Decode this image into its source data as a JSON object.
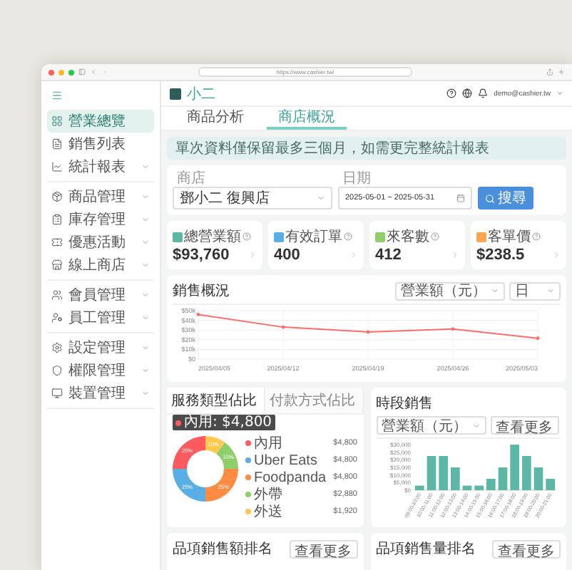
{
  "browser": {
    "url": "https://www.cashier.tw/"
  },
  "sidebar": {
    "groups": [
      {
        "items": [
          {
            "label": "營業總覽",
            "selected": true,
            "has_submenu": false
          },
          {
            "label": "銷售列表",
            "selected": false,
            "has_submenu": false
          },
          {
            "label": "統計報表",
            "selected": false,
            "has_submenu": true
          }
        ]
      },
      {
        "items": [
          {
            "label": "商品管理",
            "selected": false,
            "has_submenu": true
          },
          {
            "label": "庫存管理",
            "selected": false,
            "has_submenu": true
          },
          {
            "label": "優惠活動",
            "selected": false,
            "has_submenu": true
          },
          {
            "label": "線上商店",
            "selected": false,
            "has_submenu": true
          }
        ]
      },
      {
        "items": [
          {
            "label": "會員管理",
            "selected": false,
            "has_submenu": true
          },
          {
            "label": "員工管理",
            "selected": false,
            "has_submenu": true
          }
        ]
      },
      {
        "items": [
          {
            "label": "設定管理",
            "selected": false,
            "has_submenu": true
          },
          {
            "label": "權限管理",
            "selected": false,
            "has_submenu": true
          },
          {
            "label": "裝置管理",
            "selected": false,
            "has_submenu": true
          }
        ]
      }
    ]
  },
  "header": {
    "logo_text": "小二",
    "account": "demo@cashier.tw"
  },
  "tabs": [
    {
      "label": "商品分析",
      "selected": false
    },
    {
      "label": "商店概況",
      "selected": true
    }
  ],
  "notice": "單次資料僅保留最多三個月，如需更完整統計報表",
  "filter": {
    "store": {
      "label": "商店",
      "value": "鄧小二 復興店"
    },
    "date": {
      "label": "日期",
      "value": "2025-05-01 ~ 2025-05-31"
    },
    "search_button": "搜尋"
  },
  "stats": [
    {
      "label": "總營業額",
      "value": "$93,760",
      "color": "#5cb8a5"
    },
    {
      "label": "有效訂單",
      "value": "400",
      "color": "#5aaee6"
    },
    {
      "label": "來客數",
      "value": "412",
      "color": "#8fcf6a"
    },
    {
      "label": "客單價",
      "value": "$238.5",
      "color": "#ffa552"
    }
  ],
  "sales_overview": {
    "title": "銷售概況",
    "metric_select": "營業額（元）",
    "period_select": "日",
    "chart_data": {
      "type": "line",
      "grid": true,
      "x": [
        "2025/04/05",
        "2025/04/12",
        "2025/04/19",
        "2025/04/26",
        "2025/05/03"
      ],
      "series": [
        {
          "color": "#ff6b6b",
          "values": [
            46000,
            33000,
            28000,
            31000,
            21500
          ]
        }
      ],
      "ylim": [
        0,
        50000
      ],
      "yticks": [
        {
          "value": 0,
          "label": "$0"
        },
        {
          "value": 10000,
          "label": "$10k"
        },
        {
          "value": 20000,
          "label": "$20k"
        },
        {
          "value": 30000,
          "label": "$30k"
        },
        {
          "value": 40000,
          "label": "$40k"
        },
        {
          "value": 50000,
          "label": "$50k"
        }
      ]
    }
  },
  "share_card": {
    "tabs": [
      {
        "label": "服務類型佔比",
        "selected": true
      },
      {
        "label": "付款方式佔比",
        "selected": false
      }
    ],
    "chart_data": {
      "type": "donut",
      "categories": [
        "內用",
        "Uber Eats",
        "Foodpanda",
        "外帶",
        "外送"
      ],
      "values": [
        25,
        25,
        25,
        15,
        10
      ],
      "value_labels": [
        "25%",
        "25%",
        "25%",
        "15%",
        "10%"
      ],
      "colors": [
        "#ff5a5f",
        "#5aaee6",
        "#ff8c42",
        "#8fcf6a",
        "#ffc94d"
      ]
    },
    "legend_amounts": [
      "$4,800",
      "$4,800",
      "$4,800",
      "$2,880",
      "$1,920"
    ],
    "tooltip": {
      "text": "內用: $4,800",
      "color": "#ff5a5f"
    }
  },
  "hourly_card": {
    "title": "時段銷售",
    "metric_select": "營業額（元）",
    "more_button": "查看更多",
    "chart_data": {
      "type": "bar",
      "categories": [
        "09:00-10:00",
        "10:00-11:00",
        "11:00-12:00",
        "12:00-13:00",
        "13:00-14:00",
        "14:00-15:00",
        "15:00-16:00",
        "16:00-17:00",
        "17:00-18:00",
        "18:00-19:00",
        "19:00-20:00",
        "20:00-21:00"
      ],
      "series": [
        {
          "color": "#5cb8a5",
          "values": [
            3000,
            22500,
            22500,
            15000,
            3000,
            3000,
            7500,
            15000,
            30000,
            22500,
            15000,
            7500
          ]
        }
      ],
      "ylim": [
        0,
        30000
      ],
      "yticks": [
        {
          "value": 0,
          "label": "$0"
        },
        {
          "value": 5000,
          "label": "$5,000"
        },
        {
          "value": 10000,
          "label": "$10,000"
        },
        {
          "value": 15000,
          "label": "$15,000"
        },
        {
          "value": 20000,
          "label": "$20,000"
        },
        {
          "value": 25000,
          "label": "$25,000"
        },
        {
          "value": 30000,
          "label": "$30,000"
        }
      ]
    }
  },
  "ranking_cards": [
    {
      "title": "品項銷售額排名",
      "more_button": "查看更多"
    },
    {
      "title": "品項銷售量排名",
      "more_button": "查看更多"
    }
  ]
}
